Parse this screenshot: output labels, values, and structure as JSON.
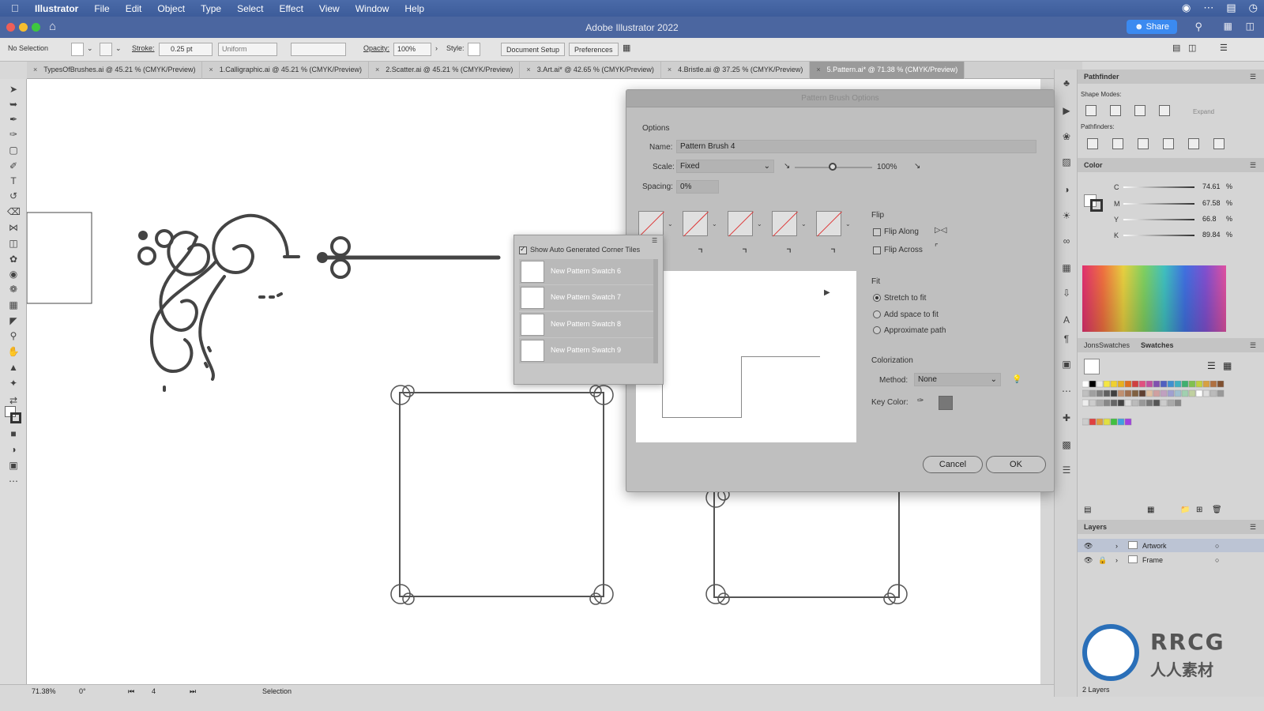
{
  "menubar": {
    "app": "Illustrator",
    "items": [
      "File",
      "Edit",
      "Object",
      "Type",
      "Select",
      "Effect",
      "View",
      "Window",
      "Help"
    ]
  },
  "window": {
    "title": "Adobe Illustrator 2022",
    "share": "Share"
  },
  "control": {
    "selection": "No Selection",
    "stroke_label": "Stroke:",
    "stroke_value": "0.25 pt",
    "profile": "Uniform",
    "opacity_label": "Opacity:",
    "opacity_value": "100%",
    "style_label": "Style:",
    "document_setup": "Document Setup",
    "preferences": "Preferences"
  },
  "tabs": [
    {
      "label": "TypesOfBrushes.ai @ 45.21 % (CMYK/Preview)"
    },
    {
      "label": "1.Calligraphic.ai @ 45.21 % (CMYK/Preview)"
    },
    {
      "label": "2.Scatter.ai @ 45.21 % (CMYK/Preview)"
    },
    {
      "label": "3.Art.ai* @ 42.65 % (CMYK/Preview)"
    },
    {
      "label": "4.Bristle.ai @ 37.25 % (CMYK/Preview)"
    },
    {
      "label": "5.Pattern.ai* @ 71.38 % (CMYK/Preview)"
    }
  ],
  "dialog": {
    "title": "Pattern Brush Options",
    "options_label": "Options",
    "name_label": "Name:",
    "name_value": "Pattern Brush 4",
    "scale_label": "Scale:",
    "scale_mode": "Fixed",
    "scale_value": "100%",
    "spacing_label": "Spacing:",
    "spacing_value": "0%",
    "flip_label": "Flip",
    "flip_along": "Flip Along",
    "flip_across": "Flip Across",
    "fit_label": "Fit",
    "fit_options": [
      "Stretch to fit",
      "Add space to fit",
      "Approximate path"
    ],
    "colorization_label": "Colorization",
    "method_label": "Method:",
    "method_value": "None",
    "key_color_label": "Key Color:",
    "cancel": "Cancel",
    "ok": "OK"
  },
  "popup": {
    "show_auto": "Show Auto Generated Corner Tiles",
    "items": [
      "New Pattern Swatch 6",
      "New Pattern Swatch 7",
      "New Pattern Swatch 8",
      "New Pattern Swatch 9"
    ]
  },
  "pathfinder": {
    "title": "Pathfinder",
    "shape_modes": "Shape Modes:",
    "pathfinders": "Pathfinders:",
    "expand": "Expand"
  },
  "color": {
    "title": "Color",
    "channels": [
      {
        "name": "C",
        "value": "74.61",
        "unit": "%"
      },
      {
        "name": "M",
        "value": "67.58",
        "unit": "%"
      },
      {
        "name": "Y",
        "value": "66.8",
        "unit": "%"
      },
      {
        "name": "K",
        "value": "89.84",
        "unit": "%"
      }
    ]
  },
  "swatches": {
    "tab1": "JonsSwatches",
    "tab2": "Swatches"
  },
  "layers": {
    "title": "Layers",
    "items": [
      {
        "name": "Artwork"
      },
      {
        "name": "Frame"
      }
    ],
    "count": "2 Layers"
  },
  "status": {
    "zoom": "71.38%",
    "rotation": "0°",
    "artboard": "4",
    "tool": "Selection"
  },
  "watermark": {
    "text": "RRCG",
    "cn": "人人素材"
  }
}
